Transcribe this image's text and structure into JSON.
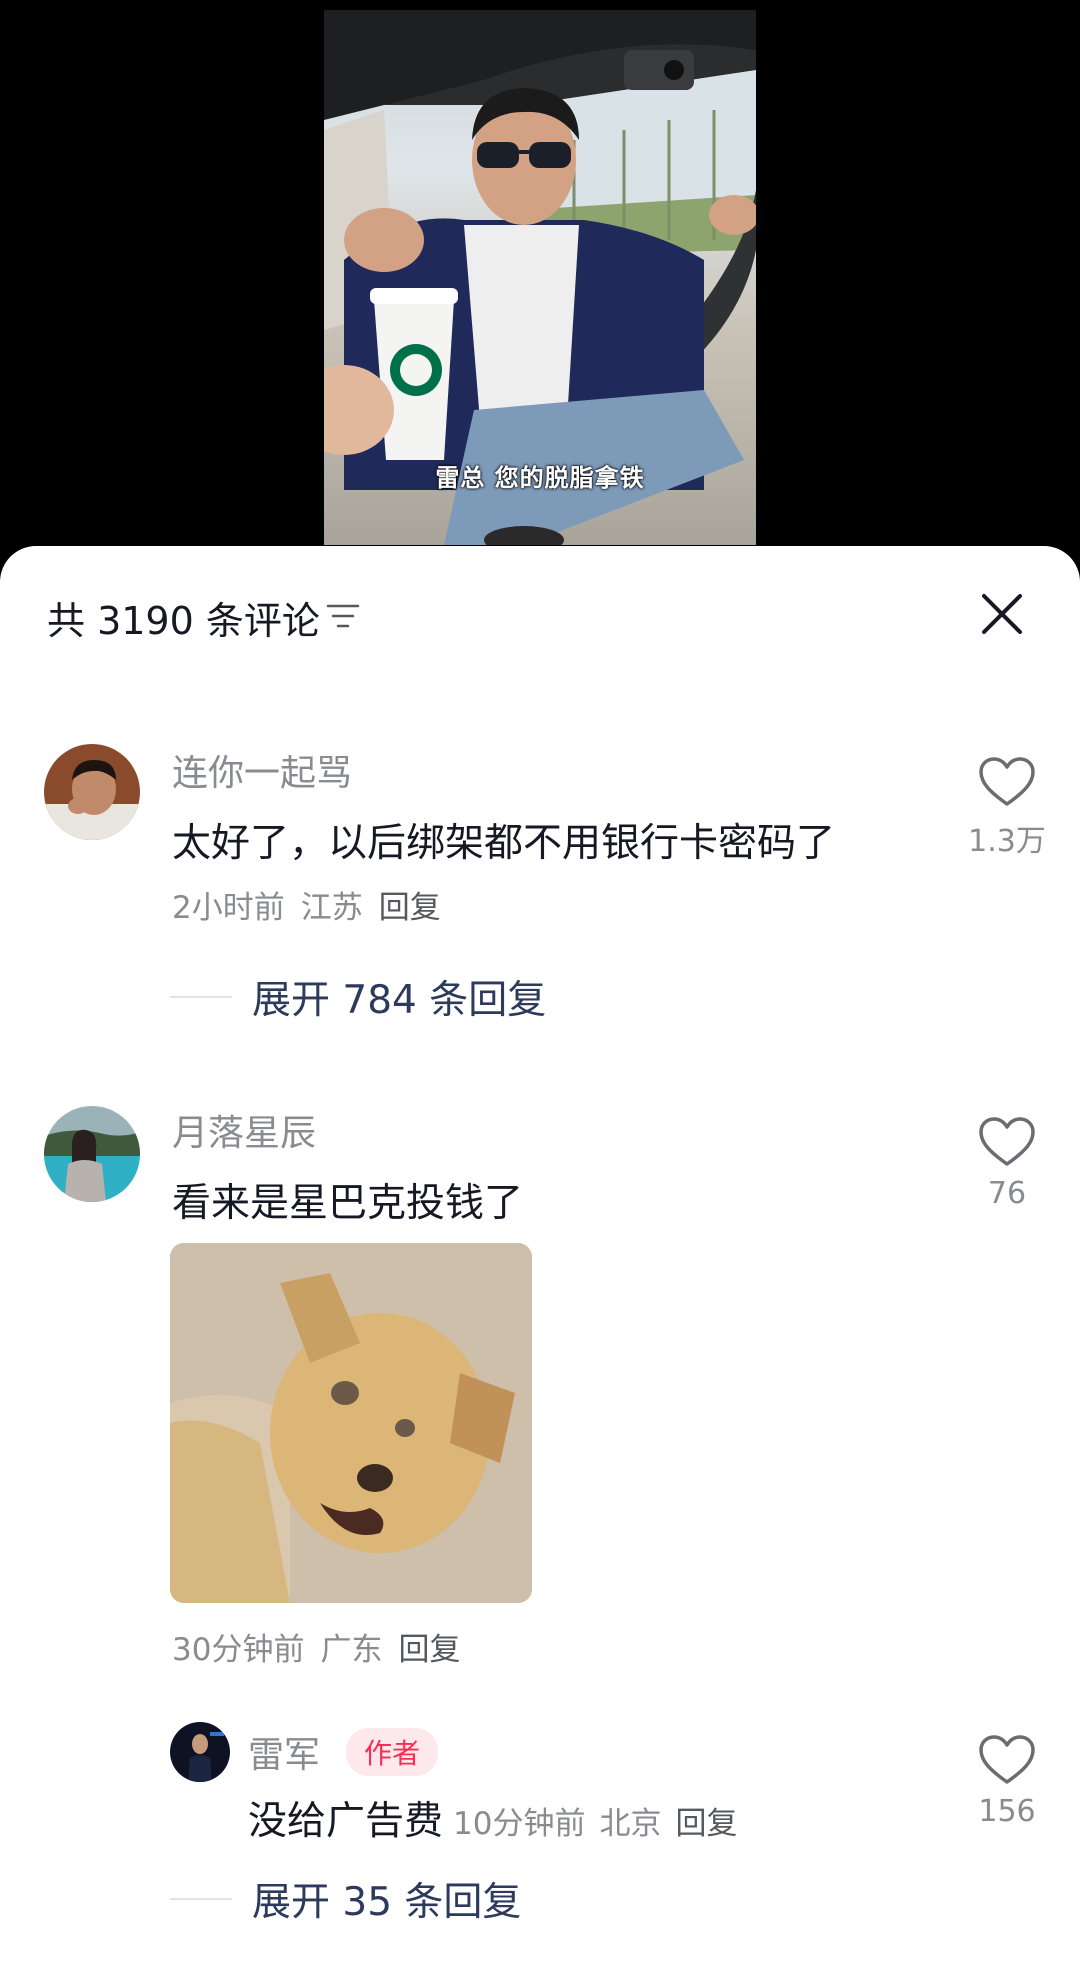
{
  "video": {
    "caption": "雷总 您的脱脂拿铁"
  },
  "comments_panel": {
    "title": "共 3190 条评论",
    "sort_icon": "filter-lines-icon",
    "close_icon": "close-x-icon"
  },
  "comments": [
    {
      "username": "连你一起骂",
      "text": "太好了，以后绑架都不用银行卡密码了",
      "time": "2小时前",
      "location": "江苏",
      "reply_label": "回复",
      "likes": "1.3万",
      "expand_label": "展开 784 条回复"
    },
    {
      "username": "月落星辰",
      "text": "看来是星巴克投钱了",
      "time": "30分钟前",
      "location": "广东",
      "reply_label": "回复",
      "likes": "76",
      "reply": {
        "username": "雷军",
        "author_tag": "作者",
        "text": "没给广告费",
        "time": "10分钟前",
        "location": "北京",
        "reply_label": "回复",
        "likes": "156"
      },
      "expand_label": "展开 35 条回复"
    }
  ],
  "colors": {
    "accent_red": "#fe2c55",
    "expand_blue": "#2c3a5c",
    "meta_gray": "#8a8b91"
  }
}
